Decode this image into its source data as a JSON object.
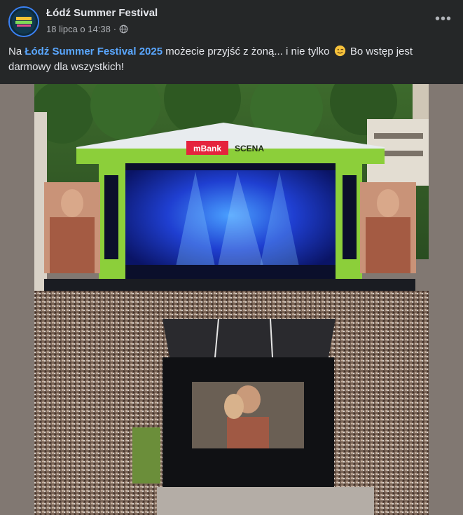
{
  "post": {
    "page_name": "Łódź Summer Festival",
    "timestamp": "18 lipca o 14:38",
    "separator": "·",
    "visibility_icon": "globe-icon",
    "more_label": "•••"
  },
  "caption": {
    "prefix": "Na ",
    "link_text": "Łódź Summer Festival 2025",
    "middle": " możecie przyjść z żoną... i nie tylko ",
    "emoji": "winking-face-emoji",
    "suffix": " Bo wstęp jest darmowy dla wszystkich!"
  },
  "photo": {
    "stage_brand": "mBank",
    "stage_label": "SCENA",
    "alt": "Festival stage with large crowd"
  },
  "colors": {
    "background": "#252728",
    "link": "#5aa7ff",
    "stage_green": "#8ccf3a",
    "stage_blue": "#1f3fd1",
    "brand_red": "#e5233d"
  }
}
